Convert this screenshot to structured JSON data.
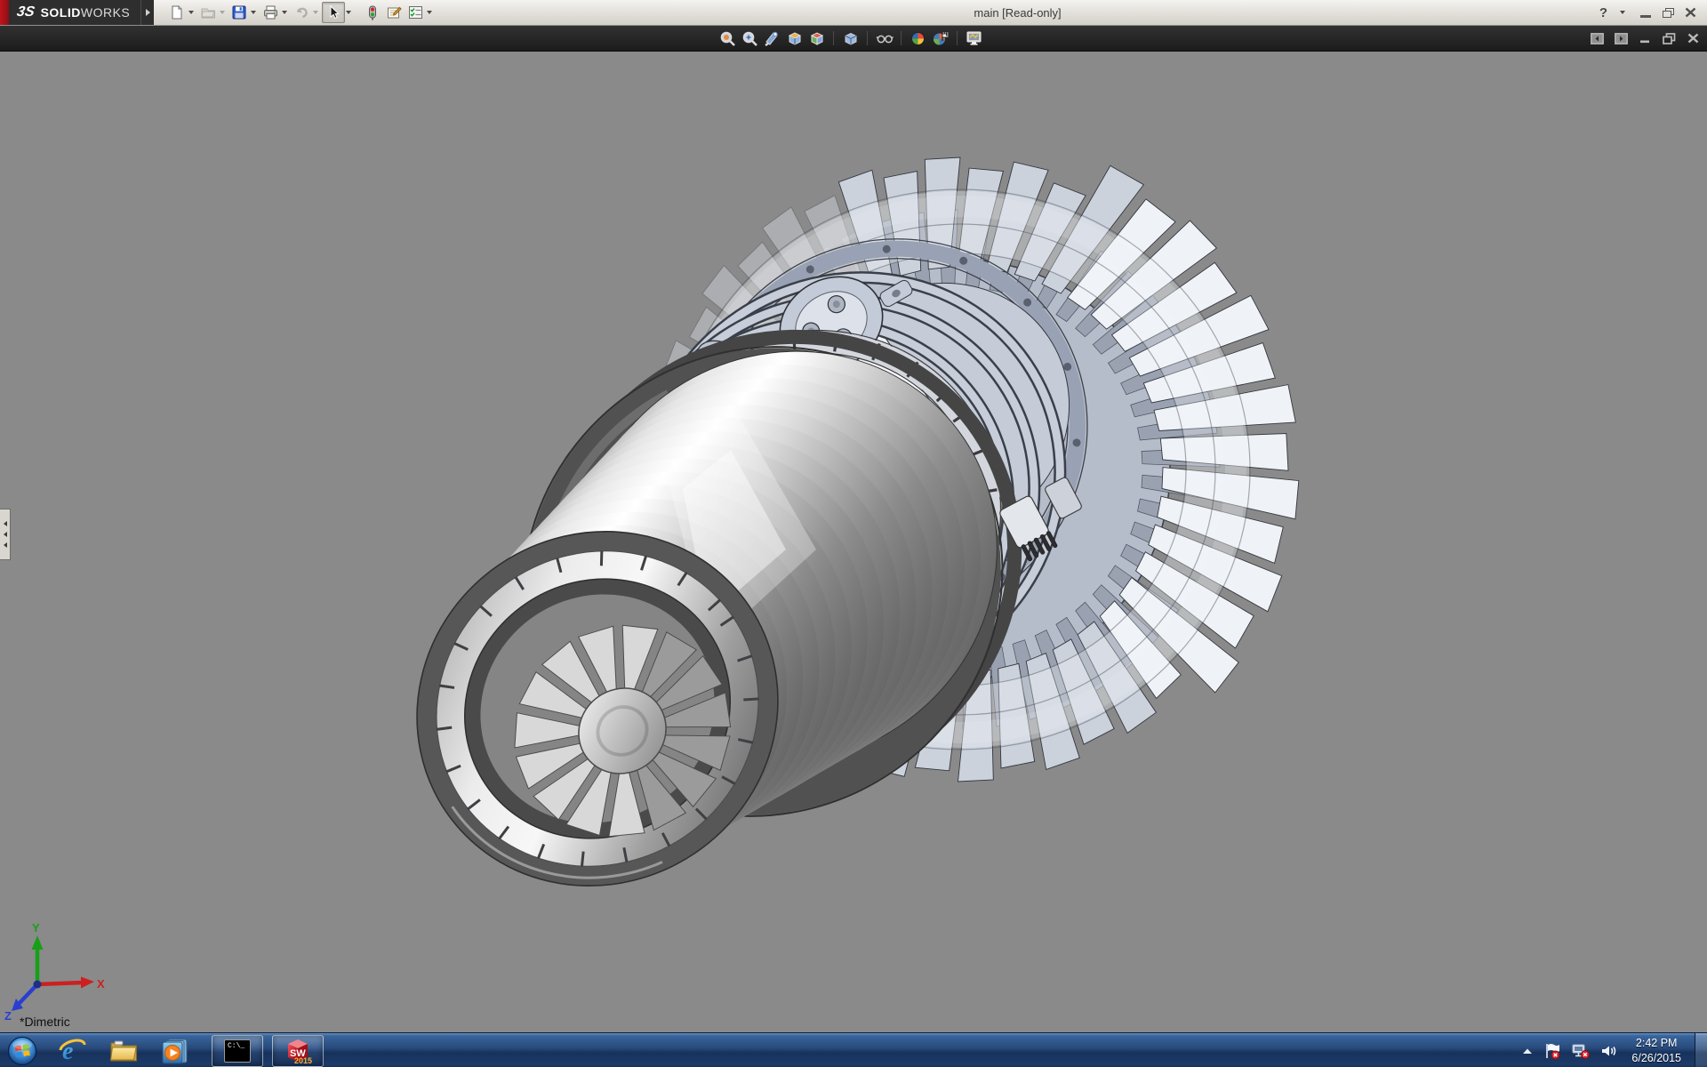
{
  "window": {
    "title": "main [Read-only]",
    "brand_mark": "3S",
    "brand_solid": "SOLID",
    "brand_works": "WORKS",
    "help_glyph": "?"
  },
  "main_toolbar": {
    "items": [
      {
        "name": "new-document",
        "grayed": false
      },
      {
        "name": "open-document",
        "grayed": true
      },
      {
        "name": "save",
        "grayed": false
      },
      {
        "name": "print",
        "grayed": false
      },
      {
        "name": "undo",
        "grayed": true
      },
      {
        "name": "select-tool",
        "pressed": true
      },
      {
        "name": "stoplight",
        "grayed": false
      },
      {
        "name": "comment",
        "grayed": false
      },
      {
        "name": "options",
        "grayed": false
      }
    ]
  },
  "heads_up_toolbar": {
    "items": [
      {
        "name": "zoom-to-fit"
      },
      {
        "name": "zoom-to-area"
      },
      {
        "name": "previous-view"
      },
      {
        "name": "section-view"
      },
      {
        "name": "view-orientation"
      },
      {
        "name": "display-style"
      },
      {
        "name": "hide-show-items"
      },
      {
        "name": "edit-appearance"
      },
      {
        "name": "apply-scene"
      },
      {
        "name": "view-settings"
      }
    ]
  },
  "document_controls": {
    "items": [
      {
        "name": "show-left-pane"
      },
      {
        "name": "show-right-pane"
      },
      {
        "name": "minimize-document"
      },
      {
        "name": "restore-document"
      },
      {
        "name": "close-document"
      }
    ]
  },
  "viewport": {
    "status_text": "*Dimetric",
    "background": "#8a8a8a",
    "triad": {
      "x_label": "X",
      "y_label": "Y",
      "z_label": "Z",
      "x_color": "#cc2020",
      "y_color": "#17a017",
      "z_color": "#2a3fd0"
    }
  },
  "taskbar": {
    "background": "#24497c",
    "items": [
      {
        "name": "start"
      },
      {
        "name": "internet-explorer"
      },
      {
        "name": "windows-explorer"
      },
      {
        "name": "media-player"
      },
      {
        "name": "command-prompt",
        "label": "C:\\_",
        "active": true
      },
      {
        "name": "solidworks-2015",
        "label": "SW",
        "year": "2015",
        "active": true
      }
    ],
    "tray": {
      "clock_time": "2:42 PM",
      "clock_date": "6/26/2015",
      "icons": [
        {
          "name": "show-hidden-icons"
        },
        {
          "name": "action-center"
        },
        {
          "name": "network-offline"
        },
        {
          "name": "volume"
        }
      ]
    }
  }
}
